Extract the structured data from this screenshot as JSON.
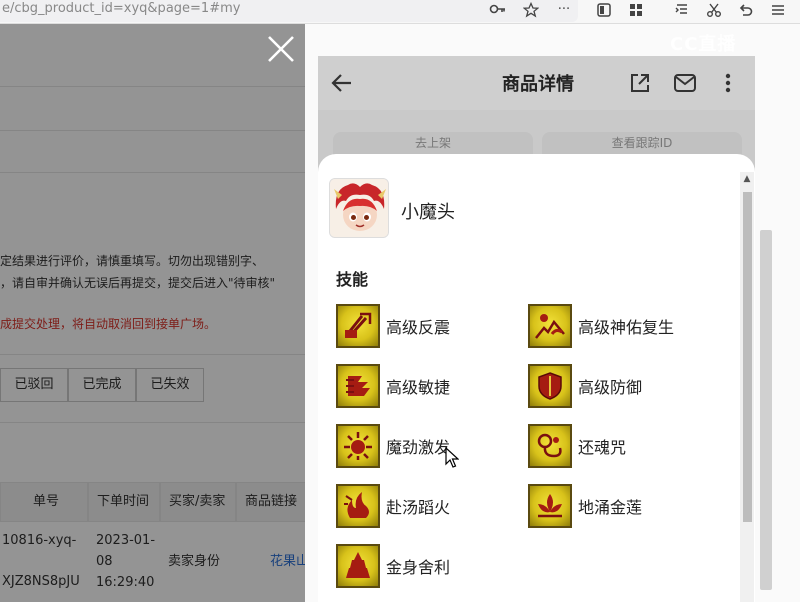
{
  "browser": {
    "url": "e/cbg_product_id=xyq&page=1#my"
  },
  "background_page": {
    "text_line1": "定结果进行评价，请慎重填写。切勿出现错别字、",
    "text_line2": "，请自审并确认无误后再提交，提交后进入\"待审核\"",
    "text_red": "成提交处理，将自动取消回到接单广场。",
    "tabs": [
      "已驳回",
      "已完成",
      "已失效"
    ],
    "table_headers": [
      "单号",
      "下单时间",
      "买家/卖家",
      "商品链接"
    ],
    "row": {
      "order_id_1": "10816-xyq-",
      "order_id_2": "XJZ8NS8pJU",
      "date_1": "2023-01-",
      "date_2": "08",
      "time": "16:29:40",
      "role": "卖家身份",
      "link": "花果山"
    }
  },
  "watermark": "CC直播",
  "phone": {
    "title": "商品详情",
    "tab_left": "去上架",
    "tab_right": "查看跟踪ID",
    "pet_name": "小魔头",
    "section_title": "技能",
    "skills": [
      {
        "label": "高级反震",
        "icon": "counterattack-skill-icon"
      },
      {
        "label": "高级神佑复生",
        "icon": "revive-skill-icon"
      },
      {
        "label": "高级敏捷",
        "icon": "agility-skill-icon"
      },
      {
        "label": "高级防御",
        "icon": "shield-skill-icon"
      },
      {
        "label": "魔劲激发",
        "icon": "burst-skill-icon"
      },
      {
        "label": "还魂咒",
        "icon": "soul-skill-icon"
      },
      {
        "label": "赴汤蹈火",
        "icon": "fire-skill-icon"
      },
      {
        "label": "地涌金莲",
        "icon": "lotus-skill-icon"
      },
      {
        "label": "金身舍利",
        "icon": "pagoda-skill-icon"
      }
    ]
  }
}
